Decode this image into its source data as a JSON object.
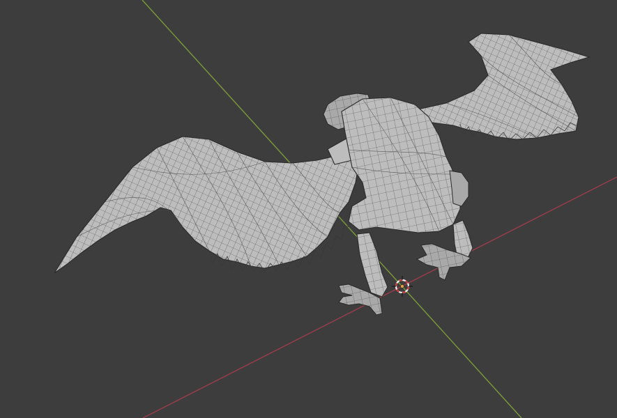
{
  "viewport": {
    "background": "#3d3d3d",
    "object_name": "bird-wireframe-mesh",
    "axis_colors": {
      "x": "#9a3d4a",
      "y": "#7a9a3a"
    },
    "mesh_color": "#bdbdbd",
    "wire_color": "#2a2a2a",
    "cursor_colors": {
      "ring_a": "#c8393a",
      "ring_b": "#f0f0f0",
      "center": "#e8a33a"
    }
  }
}
